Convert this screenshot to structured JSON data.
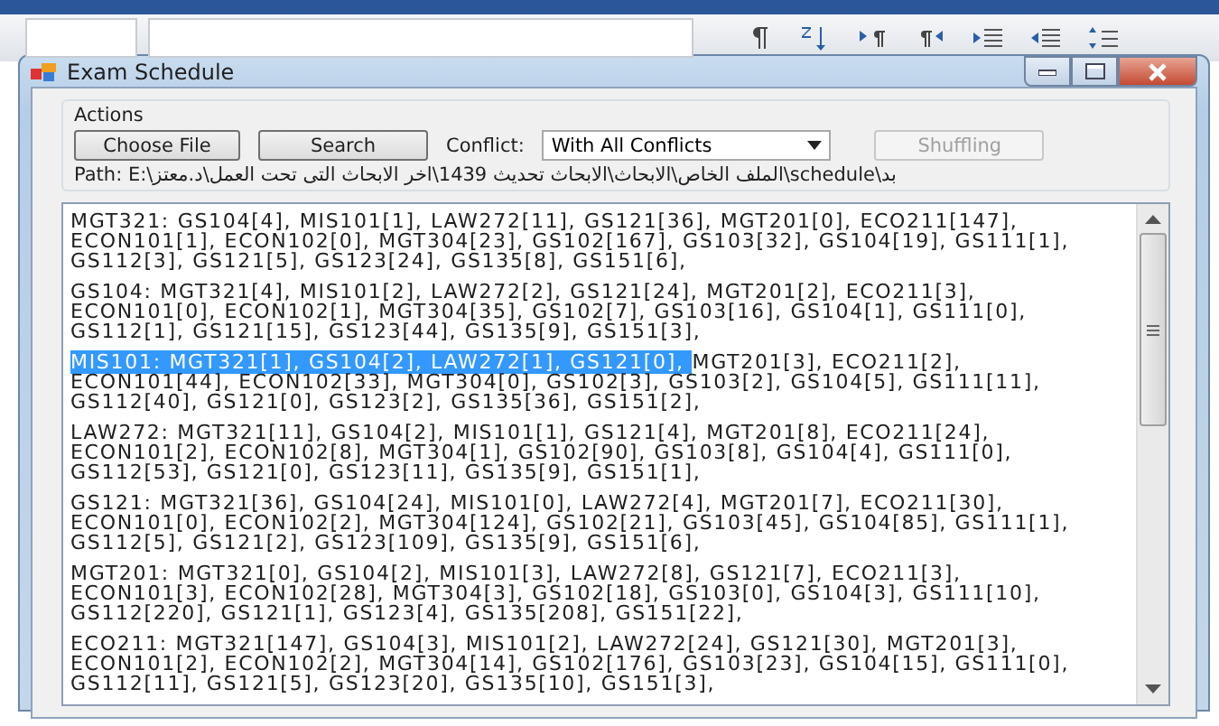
{
  "window": {
    "title": "Exam Schedule"
  },
  "actions": {
    "title": "Actions",
    "choose_file_button": "Choose File",
    "search_button": "Search",
    "conflict_label": "Conflict:",
    "conflict_value": "With All Conflicts",
    "shuffling_button": {
      "label": "Shuffling",
      "disabled": true
    },
    "path": "Path: E:\\الملف الخاص\\الابحاث\\الابحاث تحديث 1439\\اخر الابحاث التى تحت العمل\\د.معتز\\schedule\\بد"
  },
  "results": {
    "paragraphs": [
      {
        "lines": [
          [
            {
              "text": "MGT321: GS104[4], MIS101[1], LAW272[11], GS121[36], MGT201[0], ECO211[147],",
              "selected": false
            }
          ],
          [
            {
              "text": "ECON101[1], ECON102[0], MGT304[23], GS102[167], GS103[32], GS104[19], GS111[1],",
              "selected": false
            }
          ],
          [
            {
              "text": "GS112[3], GS121[5], GS123[24], GS135[8], GS151[6],",
              "selected": false
            }
          ]
        ]
      },
      {
        "lines": [
          [
            {
              "text": "GS104: MGT321[4], MIS101[2], LAW272[2], GS121[24], MGT201[2], ECO211[3],",
              "selected": false
            }
          ],
          [
            {
              "text": "ECON101[0], ECON102[1], MGT304[35], GS102[7], GS103[16], GS104[1], GS111[0],",
              "selected": false
            }
          ],
          [
            {
              "text": "GS112[1], GS121[15], GS123[44], GS135[9], GS151[3],",
              "selected": false
            }
          ]
        ]
      },
      {
        "lines": [
          [
            {
              "text": "MIS101: MGT321[1], GS104[2], LAW272[1], GS121[0], ",
              "selected": true
            },
            {
              "text": "MGT201[3], ECO211[2],",
              "selected": false
            }
          ],
          [
            {
              "text": "ECON101[44], ECON102[33], MGT304[0], GS102[3], GS103[2], GS104[5], GS111[11],",
              "selected": false
            }
          ],
          [
            {
              "text": "GS112[40], GS121[0], GS123[2], GS135[36], GS151[2],",
              "selected": false
            }
          ]
        ]
      },
      {
        "lines": [
          [
            {
              "text": "LAW272: MGT321[11], GS104[2], MIS101[1], GS121[4], MGT201[8], ECO211[24],",
              "selected": false
            }
          ],
          [
            {
              "text": "ECON101[2], ECON102[8], MGT304[1], GS102[90], GS103[8], GS104[4], GS111[0],",
              "selected": false
            }
          ],
          [
            {
              "text": "GS112[53], GS121[0], GS123[11], GS135[9], GS151[1],",
              "selected": false
            }
          ]
        ]
      },
      {
        "lines": [
          [
            {
              "text": "GS121: MGT321[36], GS104[24], MIS101[0], LAW272[4], MGT201[7], ECO211[30],",
              "selected": false
            }
          ],
          [
            {
              "text": "ECON101[0], ECON102[2], MGT304[124], GS102[21], GS103[45], GS104[85], GS111[1],",
              "selected": false
            }
          ],
          [
            {
              "text": "GS112[5], GS121[2], GS123[109], GS135[9], GS151[6],",
              "selected": false
            }
          ]
        ]
      },
      {
        "lines": [
          [
            {
              "text": "MGT201: MGT321[0], GS104[2], MIS101[3], LAW272[8], GS121[7], ECO211[3],",
              "selected": false
            }
          ],
          [
            {
              "text": "ECON101[3], ECON102[28], MGT304[3], GS102[18], GS103[0], GS104[3], GS111[10],",
              "selected": false
            }
          ],
          [
            {
              "text": "GS112[220], GS121[1], GS123[4], GS135[208], GS151[22],",
              "selected": false
            }
          ]
        ]
      },
      {
        "lines": [
          [
            {
              "text": "ECO211: MGT321[147], GS104[3], MIS101[2], LAW272[24], GS121[30], MGT201[3],",
              "selected": false
            }
          ],
          [
            {
              "text": "ECON101[2], ECON102[2], MGT304[14], GS102[176], GS103[23], GS104[15], GS111[0],",
              "selected": false
            }
          ],
          [
            {
              "text": "GS112[11], GS121[5], GS123[20], GS135[10], GS151[3],",
              "selected": false
            }
          ]
        ]
      }
    ]
  }
}
